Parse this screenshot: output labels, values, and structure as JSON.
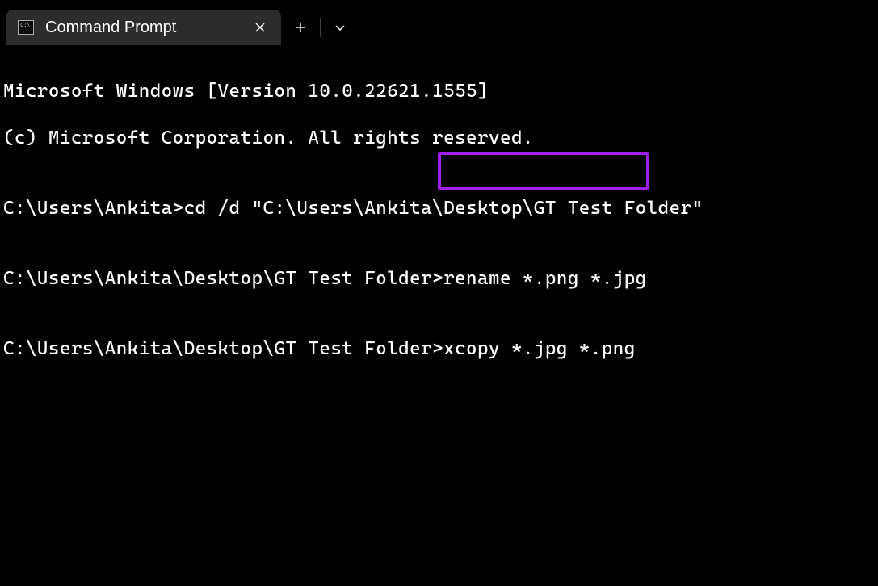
{
  "titlebar": {
    "tab_title": "Command Prompt",
    "tab_icon_label": "C:\\",
    "close_symbol": "✕",
    "new_tab_symbol": "+",
    "dropdown_symbol": "⌄"
  },
  "terminal": {
    "lines": [
      "Microsoft Windows [Version 10.0.22621.1555]",
      "(c) Microsoft Corporation. All rights reserved.",
      "",
      "C:\\Users\\Ankita>cd /d \"C:\\Users\\Ankita\\Desktop\\GT Test Folder\"",
      "",
      "C:\\Users\\Ankita\\Desktop\\GT Test Folder>rename *.png *.jpg",
      "",
      "C:\\Users\\Ankita\\Desktop\\GT Test Folder>xcopy *.jpg *.png"
    ]
  },
  "annotation": {
    "highlighted_command": "xcopy *.jpg *.png",
    "color": "#a020f0"
  }
}
